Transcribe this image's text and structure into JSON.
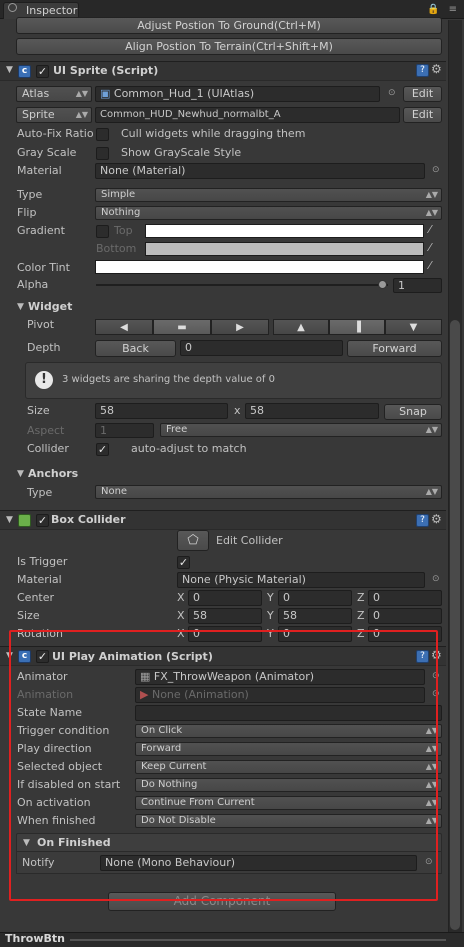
{
  "tab": {
    "title": "Inspector"
  },
  "top_buttons": {
    "adjust": "Adjust Postion To Ground(Ctrl+M)",
    "align": "Align Postion To Terrain(Ctrl+Shift+M)"
  },
  "ui_sprite": {
    "title": "UI Sprite (Script)",
    "atlas_dd": "Atlas",
    "atlas_value": "Common_Hud_1 (UIAtlas)",
    "edit1": "Edit",
    "sprite_dd": "Sprite",
    "sprite_value": "Common_HUD_Newhud_normalbt_A",
    "edit2": "Edit",
    "autofix_label": "Auto-Fix Ratio",
    "cull_label": "Cull widgets while dragging them",
    "grayscale_label": "Gray Scale",
    "grayscale_show": "Show GrayScale Style",
    "material_label": "Material",
    "material_value": "None (Material)",
    "type_label": "Type",
    "type_value": "Simple",
    "flip_label": "Flip",
    "flip_value": "Nothing",
    "gradient_label": "Gradient",
    "top_label": "Top",
    "bottom_label": "Bottom",
    "colortint_label": "Color Tint",
    "alpha_label": "Alpha",
    "alpha_value": "1",
    "alpha_level": 1
  },
  "widget": {
    "title": "Widget",
    "pivot_label": "Pivot",
    "pivot_h": [
      "◀",
      "▬",
      "▶"
    ],
    "pivot_v": [
      "▲",
      "▐",
      "▼"
    ],
    "depth_label": "Depth",
    "back": "Back",
    "depth_value": "0",
    "forward": "Forward",
    "info": "3 widgets are sharing the depth value of 0",
    "size_label": "Size",
    "size_x": "58",
    "x_label": "x",
    "size_y": "58",
    "snap": "Snap",
    "aspect_label": "Aspect",
    "aspect_value": "1",
    "aspect_mode": "Free",
    "collider_label": "Collider",
    "collider_text": "auto-adjust to match"
  },
  "anchors": {
    "title": "Anchors",
    "type_label": "Type",
    "type_value": "None"
  },
  "box_collider": {
    "title": "Box Collider",
    "edit_collider": "Edit Collider",
    "is_trigger": "Is Trigger",
    "material_label": "Material",
    "material_value": "None (Physic Material)",
    "center_label": "Center",
    "size_label": "Size",
    "rotation_label": "Rotation",
    "center": {
      "x": "0",
      "y": "0",
      "z": "0"
    },
    "size": {
      "x": "58",
      "y": "58",
      "z": "0"
    },
    "rotation": {
      "x": "0",
      "y": "0",
      "z": "0"
    },
    "axis": {
      "x": "X",
      "y": "Y",
      "z": "Z"
    }
  },
  "play_anim": {
    "title": "UI Play Animation (Script)",
    "animator_label": "Animator",
    "animator_value": "FX_ThrowWeapon (Animator)",
    "animation_label": "Animation",
    "animation_value": "None (Animation)",
    "state_label": "State Name",
    "state_value": "",
    "trigger_label": "Trigger condition",
    "trigger_value": "On Click",
    "direction_label": "Play direction",
    "direction_value": "Forward",
    "selected_label": "Selected object",
    "selected_value": "Keep Current",
    "disabled_label": "If disabled on start",
    "disabled_value": "Do Nothing",
    "activation_label": "On activation",
    "activation_value": "Continue From Current",
    "finished_label": "When finished",
    "finished_value": "Do Not Disable",
    "onfinished_title": "On Finished",
    "notify_label": "Notify",
    "notify_value": "None (Mono Behaviour)"
  },
  "add_component": "Add Component",
  "footer": {
    "object_name": "ThrowBtn"
  },
  "colors": {
    "highlight": "#e02020",
    "panel": "#383838"
  }
}
